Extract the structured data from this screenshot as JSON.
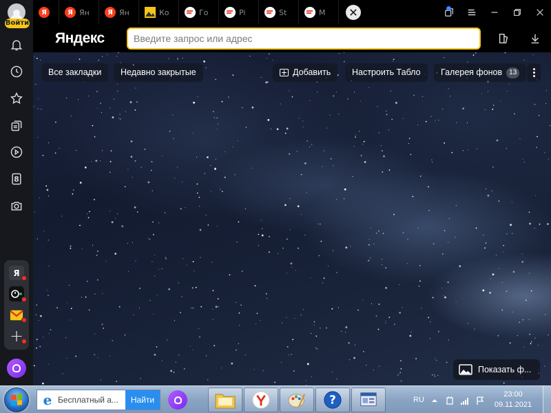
{
  "sidebar": {
    "login_label": "Войти",
    "icons": [
      "bell-icon",
      "history-icon",
      "star-icon",
      "collections-icon",
      "video-icon",
      "counter-icon",
      "screenshot-icon"
    ],
    "counter_value": "8",
    "apps": [
      {
        "name": "yandex-app",
        "glyph": "Я"
      },
      {
        "name": "music-app",
        "glyph": ""
      },
      {
        "name": "mail-app",
        "glyph": ""
      },
      {
        "name": "add-app",
        "glyph": "+"
      }
    ]
  },
  "tabs": [
    {
      "title": "",
      "favicon": "ya-favicon",
      "letter": "Я"
    },
    {
      "title": "Ян",
      "favicon": "ya-favicon",
      "letter": "Я"
    },
    {
      "title": "Ян",
      "favicon": "ya-favicon",
      "letter": "Я"
    },
    {
      "title": "Ко",
      "favicon": "image-favicon",
      "letter": ""
    },
    {
      "title": "Го",
      "favicon": "site-favicon",
      "letter": ""
    },
    {
      "title": "Pi",
      "favicon": "site-favicon",
      "letter": ""
    },
    {
      "title": "St",
      "favicon": "site-favicon",
      "letter": ""
    },
    {
      "title": "M",
      "favicon": "site-favicon",
      "letter": ""
    }
  ],
  "toolbar": {
    "brand": "Яндекс",
    "address_placeholder": "Введите запрос или адрес"
  },
  "bookmarks": {
    "all_bookmarks": "Все закладки",
    "recently_closed": "Недавно закрытые",
    "add": "Добавить",
    "customize": "Настроить Табло",
    "gallery": "Галерея фонов",
    "gallery_count": "13"
  },
  "show_background": "Показать ф...",
  "taskbar": {
    "search_value": "Бесплатный а...",
    "find_label": "Найти",
    "language": "RU",
    "time": "23:00",
    "date": "09.11.2021"
  },
  "colors": {
    "accent_yellow": "#f5c518",
    "yandex_red": "#fc3f1d",
    "alice_purple": "#8a3cf5",
    "notification_dot": "#ff2a2a"
  }
}
